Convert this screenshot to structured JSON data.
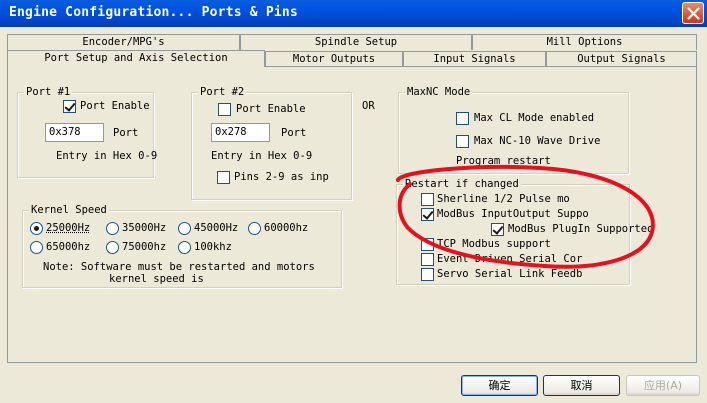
{
  "window": {
    "title": "Engine Configuration... Ports & Pins"
  },
  "tabs_back": [
    {
      "label": "Encoder/MPG's"
    },
    {
      "label": "Spindle Setup"
    },
    {
      "label": "Mill Options"
    }
  ],
  "tabs_front": [
    {
      "label": "Port Setup and Axis Selection"
    },
    {
      "label": "Motor Outputs"
    },
    {
      "label": "Input Signals"
    },
    {
      "label": "Output Signals"
    }
  ],
  "port1": {
    "title": "Port #1",
    "enable_label": "Port Enable",
    "enabled": true,
    "address": "0x378",
    "port_label": "Port",
    "hint": "Entry in Hex 0-9"
  },
  "port2": {
    "title": "Port #2",
    "enable_label": "Port Enable",
    "enabled": false,
    "address": "0x278",
    "port_label": "Port",
    "hint": "Entry in Hex 0-9",
    "pins_label": "Pins 2-9 as inp",
    "pins_checked": false
  },
  "or_label": "OR",
  "maxnc": {
    "title": "MaxNC Mode",
    "cl_label": "Max CL Mode enabled",
    "cl_checked": false,
    "wave_label": "Max NC-10 Wave Drive",
    "wave_checked": false,
    "restart_text": "Program restart"
  },
  "restart_group": {
    "title": "Restart if changed",
    "items": [
      {
        "label": "Sherline 1/2 Pulse mo",
        "checked": false
      },
      {
        "label": "ModBus InputOutput Suppo",
        "checked": true
      },
      {
        "label": "ModBus PlugIn Supported",
        "checked": true
      },
      {
        "label": "TCP Modbus support",
        "checked": false
      },
      {
        "label": "Event Driven Serial Cor",
        "checked": false
      },
      {
        "label": "Servo Serial Link Feedb",
        "checked": false
      }
    ]
  },
  "kernel": {
    "title": "Kernel Speed",
    "options": [
      {
        "label": "25000Hz",
        "selected": true
      },
      {
        "label": "35000Hz",
        "selected": false
      },
      {
        "label": "45000Hz",
        "selected": false
      },
      {
        "label": "60000hz",
        "selected": false
      },
      {
        "label": "65000hz",
        "selected": false
      },
      {
        "label": "75000hz",
        "selected": false
      },
      {
        "label": "100khz",
        "selected": false
      }
    ],
    "note_line1": "Note: Software must be restarted and motors",
    "note_line2": "kernel speed is"
  },
  "buttons": {
    "ok": "确定",
    "cancel": "取消",
    "apply": "应用(A)"
  },
  "colors": {
    "annotation": "#e8101c",
    "title_bar": "#0054e3"
  }
}
